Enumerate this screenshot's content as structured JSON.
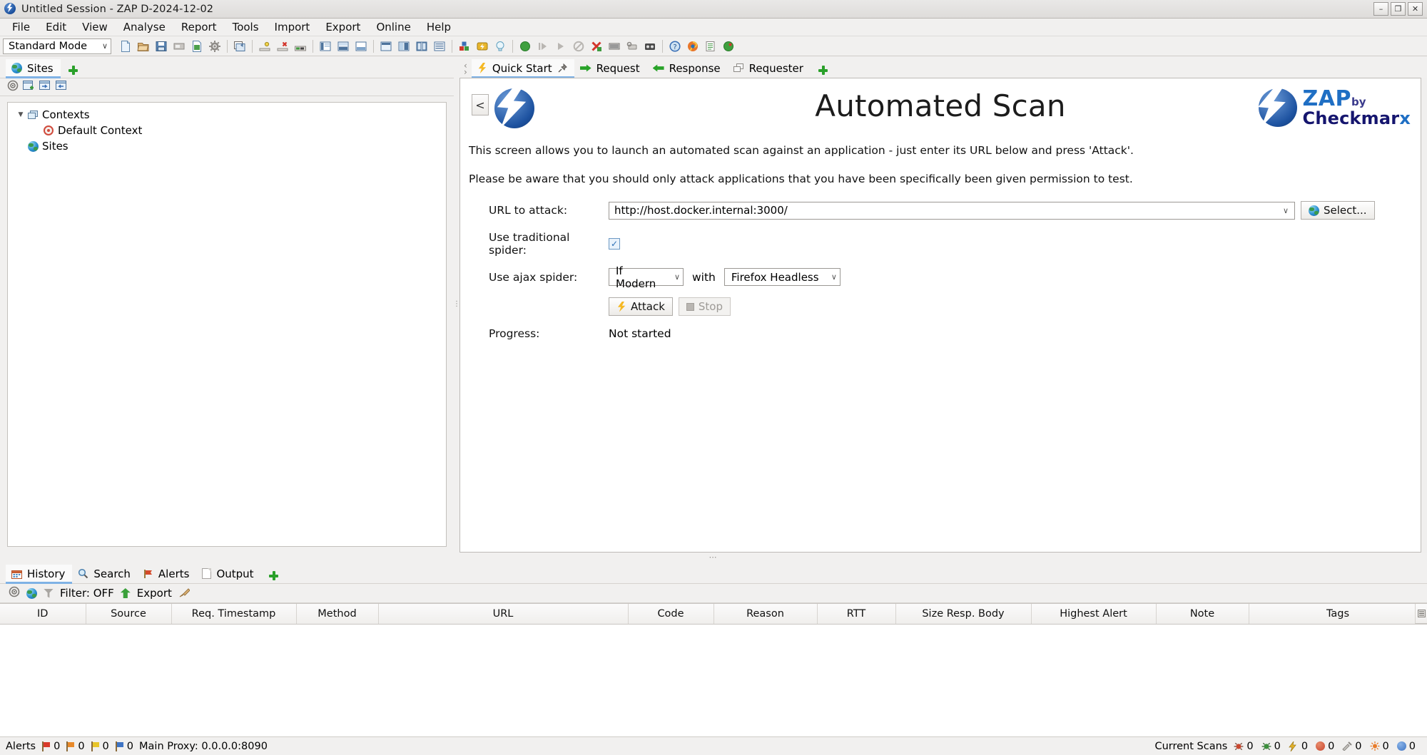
{
  "window": {
    "title": "Untitled Session - ZAP D-2024-12-02",
    "minimize": "–",
    "maximize": "❐",
    "close": "✕"
  },
  "menu": {
    "items": [
      "File",
      "Edit",
      "View",
      "Analyse",
      "Report",
      "Tools",
      "Import",
      "Export",
      "Online",
      "Help"
    ]
  },
  "toolbar": {
    "mode": "Standard Mode",
    "caret": "∨",
    "icons": [
      "new-session-icon",
      "open-session-icon",
      "save-session-icon",
      "session-properties-icon",
      "snapshot-session-icon",
      "options-icon",
      "sep",
      "manage-addons-icon",
      "sep",
      "expand-all-icon",
      "collapse-all-icon",
      "show-tab-names-icon",
      "sep",
      "layout-full-icon",
      "layout-expand-icon",
      "layout-bottom-icon",
      "sep",
      "layout-panel1-icon",
      "layout-panel2-icon",
      "layout-panel3-icon",
      "layout-panel4-icon",
      "sep",
      "addons-icon",
      "scan-policy-icon",
      "lightbulb-icon",
      "sep",
      "mode-green-icon",
      "resume-icon",
      "step-icon",
      "stop-icon",
      "clear-icon",
      "break-icon",
      "proxy-icon",
      "record-icon",
      "sep",
      "help-icon",
      "firefox-icon",
      "notes-icon",
      "spider-green-icon"
    ]
  },
  "sites_panel": {
    "tab_label": "Sites",
    "tab_icon": "globe-icon",
    "add_icon": "plus-icon",
    "toolbar_icons": [
      "target-scope-icon",
      "new-context-icon",
      "import-context-icon",
      "export-context-icon"
    ],
    "tree": [
      {
        "label": "Contexts",
        "icon": "contexts-icon",
        "depth": 0,
        "expanded": true
      },
      {
        "label": "Default Context",
        "icon": "default-context-icon",
        "depth": 1,
        "expanded": null
      },
      {
        "label": "Sites",
        "icon": "globe-icon",
        "depth": 0,
        "expanded": null
      }
    ]
  },
  "main_tabs": {
    "items": [
      {
        "label": "Quick Start",
        "icon": "lightning-icon",
        "pinned": true,
        "active": true
      },
      {
        "label": "Request",
        "icon": "arrow-right-icon",
        "pinned": false,
        "active": false
      },
      {
        "label": "Response",
        "icon": "arrow-left-icon",
        "pinned": false,
        "active": false
      },
      {
        "label": "Requester",
        "icon": "requester-icon",
        "pinned": false,
        "active": false
      }
    ],
    "add_icon": "plus-icon"
  },
  "quick_start": {
    "back_button": "<",
    "title": "Automated Scan",
    "brand": {
      "zap": "ZAP",
      "by": "by",
      "checkmarx": "Checkmar",
      "checkmarx_x": "x"
    },
    "description_1": "This screen allows you to launch an automated scan against  an application - just enter its URL below and press 'Attack'.",
    "description_2": "Please be aware that you should only attack applications that you have been specifically been given permission to test.",
    "form": {
      "url_label": "URL to attack:",
      "url_value": "http://host.docker.internal:3000/",
      "url_caret": "∨",
      "select_button": "Select...",
      "select_icon": "globe-icon",
      "spider_label": "Use traditional spider:",
      "spider_checked": "✓",
      "ajax_label": "Use ajax spider:",
      "ajax_mode": "If Modern",
      "with_word": "with",
      "browser": "Firefox Headless",
      "caret": "∨",
      "attack_button": "Attack",
      "attack_icon": "lightning-icon",
      "stop_button": "Stop",
      "stop_icon": "stop-square-icon",
      "progress_label": "Progress:",
      "progress_value": "Not started"
    }
  },
  "bottom_panel": {
    "tabs": [
      {
        "label": "History",
        "icon": "calendar-icon",
        "active": true
      },
      {
        "label": "Search",
        "icon": "magnifier-icon",
        "active": false
      },
      {
        "label": "Alerts",
        "icon": "flag-icon",
        "active": false
      },
      {
        "label": "Output",
        "icon": "document-icon",
        "active": false
      }
    ],
    "add_icon": "plus-icon",
    "filter_bar": {
      "scope_icon": "target-scope-icon",
      "globe_icon": "globe-icon",
      "funnel_icon": "funnel-icon",
      "filter_label": "Filter: OFF",
      "export_icon": "export-icon",
      "export_label": "Export",
      "brush_icon": "brush-icon"
    },
    "table": {
      "columns": [
        "ID",
        "Source",
        "Req. Timestamp",
        "Method",
        "URL",
        "Code",
        "Reason",
        "RTT",
        "Size Resp. Body",
        "Highest Alert",
        "Note",
        "Tags"
      ],
      "rows": []
    }
  },
  "status_bar": {
    "alerts_label": "Alerts",
    "alerts": [
      {
        "level": "high",
        "color": "#d93b2b",
        "count": "0"
      },
      {
        "level": "medium",
        "color": "#e8892a",
        "count": "0"
      },
      {
        "level": "low",
        "color": "#e8c52a",
        "count": "0"
      },
      {
        "level": "informational",
        "color": "#3e74c4",
        "count": "0"
      }
    ],
    "proxy": "Main Proxy: 0.0.0.0:8090",
    "current_scans_label": "Current Scans",
    "scans": [
      {
        "name": "spider-scan",
        "count": "0",
        "color": "#c9472f"
      },
      {
        "name": "ajax-spider-scan",
        "count": "0",
        "color": "#3c8f3c"
      },
      {
        "name": "active-scan",
        "count": "0",
        "color": "#e8b52a"
      },
      {
        "name": "forced-browse-scan",
        "count": "0",
        "color": "#d0452f"
      },
      {
        "name": "fuzzer-scan",
        "count": "0",
        "color": "#8a8a8a"
      },
      {
        "name": "websocket-scan",
        "count": "0",
        "color": "#e87b2a"
      },
      {
        "name": "passive-scan",
        "count": "0",
        "color": "#3e74c4"
      }
    ]
  }
}
